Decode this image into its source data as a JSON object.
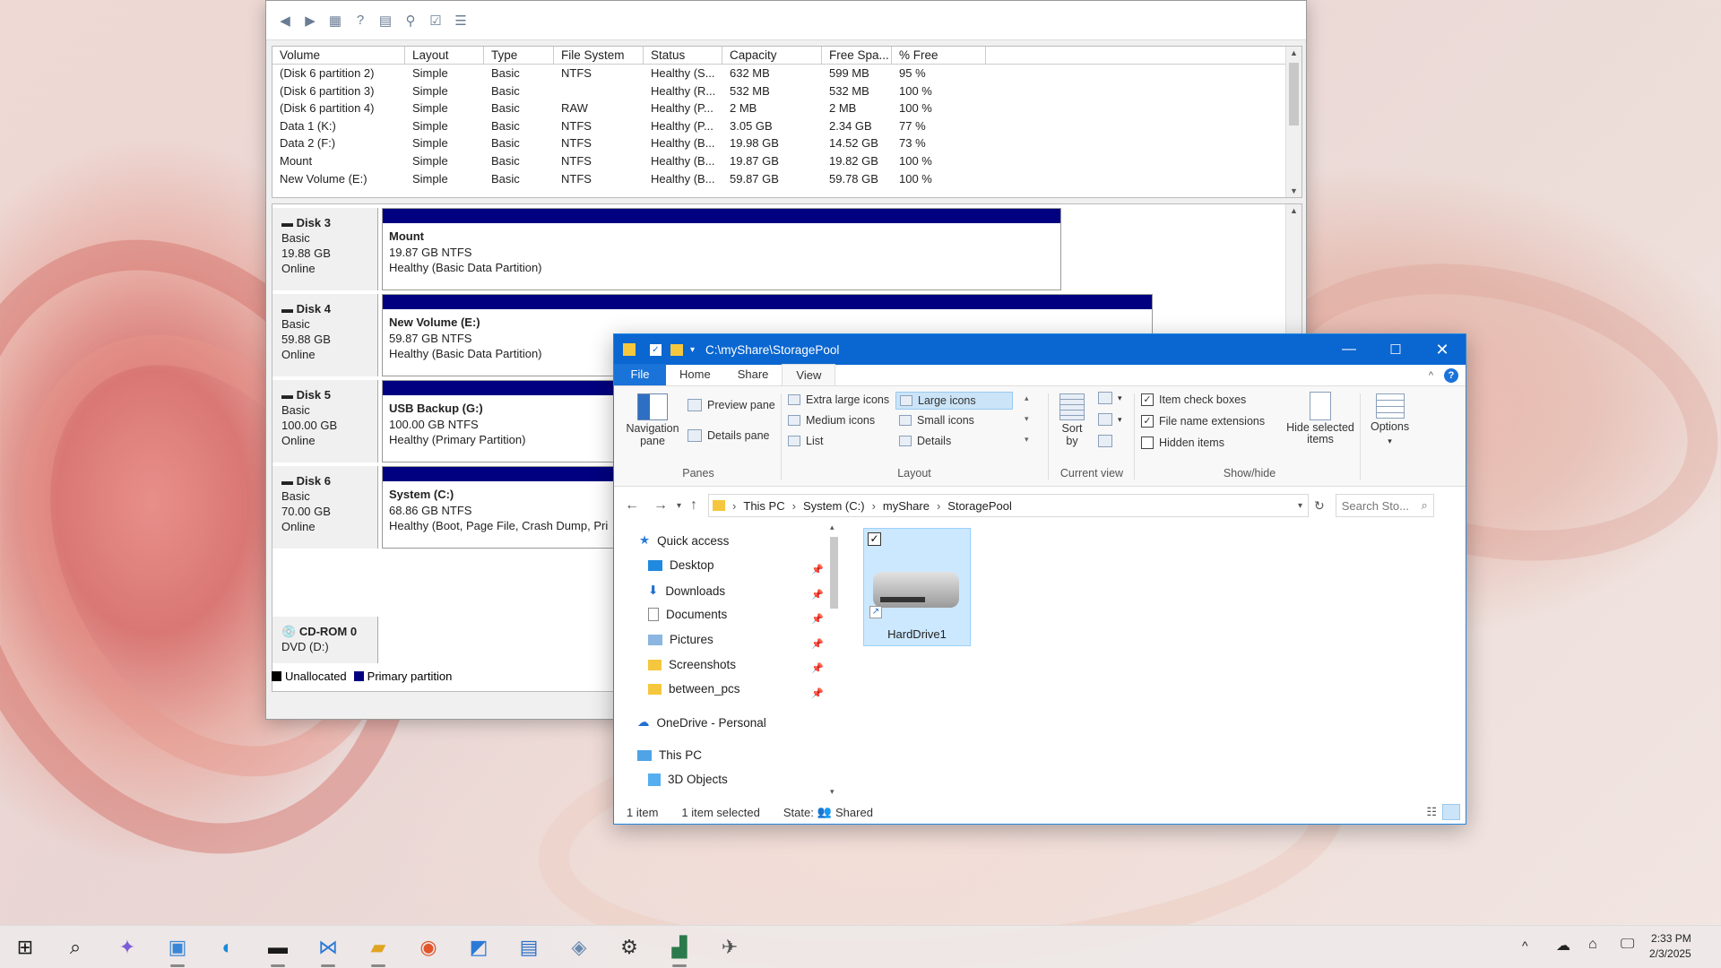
{
  "disk_mgmt": {
    "columns": [
      "Volume",
      "Layout",
      "Type",
      "File System",
      "Status",
      "Capacity",
      "Free Spa...",
      "% Free"
    ],
    "rows": [
      [
        "(Disk 6 partition 2)",
        "Simple",
        "Basic",
        "NTFS",
        "Healthy (S...",
        "632 MB",
        "599 MB",
        "95 %"
      ],
      [
        "(Disk 6 partition 3)",
        "Simple",
        "Basic",
        "",
        "Healthy (R...",
        "532 MB",
        "532 MB",
        "100 %"
      ],
      [
        "(Disk 6 partition 4)",
        "Simple",
        "Basic",
        "RAW",
        "Healthy (P...",
        "2 MB",
        "2 MB",
        "100 %"
      ],
      [
        "Data 1 (K:)",
        "Simple",
        "Basic",
        "NTFS",
        "Healthy (P...",
        "3.05 GB",
        "2.34 GB",
        "77 %"
      ],
      [
        "Data 2 (F:)",
        "Simple",
        "Basic",
        "NTFS",
        "Healthy (B...",
        "19.98 GB",
        "14.52 GB",
        "73 %"
      ],
      [
        "Mount",
        "Simple",
        "Basic",
        "NTFS",
        "Healthy (B...",
        "19.87 GB",
        "19.82 GB",
        "100 %"
      ],
      [
        "New Volume (E:)",
        "Simple",
        "Basic",
        "NTFS",
        "Healthy (B...",
        "59.87 GB",
        "59.78 GB",
        "100 %"
      ]
    ],
    "disks": [
      {
        "name": "Disk 3",
        "type": "Basic",
        "size": "19.88 GB",
        "state": "Online",
        "part_name": "Mount",
        "part_size": "19.87 GB NTFS",
        "part_status": "Healthy (Basic Data Partition)"
      },
      {
        "name": "Disk 4",
        "type": "Basic",
        "size": "59.88 GB",
        "state": "Online",
        "part_name": "New Volume  (E:)",
        "part_size": "59.87 GB NTFS",
        "part_status": "Healthy (Basic Data Partition)"
      },
      {
        "name": "Disk 5",
        "type": "Basic",
        "size": "100.00 GB",
        "state": "Online",
        "part_name": "USB Backup  (G:)",
        "part_size": "100.00 GB NTFS",
        "part_status": "Healthy (Primary Partition)"
      },
      {
        "name": "Disk 6",
        "type": "Basic",
        "size": "70.00 GB",
        "state": "Online",
        "part_name": "System  (C:)",
        "part_size": "68.86 GB NTFS",
        "part_status": "Healthy (Boot, Page File, Crash Dump, Pri"
      }
    ],
    "cdrom": {
      "name": "CD-ROM 0",
      "drive": "DVD (D:)"
    },
    "legend": {
      "unallocated": "Unallocated",
      "primary": "Primary partition"
    }
  },
  "explorer": {
    "title": "C:\\myShare\\StoragePool",
    "tabs": {
      "file": "File",
      "home": "Home",
      "share": "Share",
      "view": "View"
    },
    "ribbon": {
      "nav_pane": "Navigation pane",
      "preview_pane": "Preview pane",
      "details_pane": "Details pane",
      "panes_label": "Panes",
      "xl_icons": "Extra large icons",
      "large_icons": "Large icons",
      "medium_icons": "Medium icons",
      "small_icons": "Small icons",
      "list": "List",
      "details": "Details",
      "layout_label": "Layout",
      "sort_by": "Sort by",
      "current_view_label": "Current view",
      "item_check_boxes": "Item check boxes",
      "file_name_ext": "File name extensions",
      "hidden_items": "Hidden items",
      "hide_selected": "Hide selected items",
      "showhide_label": "Show/hide",
      "options": "Options"
    },
    "breadcrumb": [
      "This PC",
      "System (C:)",
      "myShare",
      "StoragePool"
    ],
    "search_placeholder": "Search Sto...",
    "nav": {
      "quick_access": "Quick access",
      "desktop": "Desktop",
      "downloads": "Downloads",
      "documents": "Documents",
      "pictures": "Pictures",
      "screenshots": "Screenshots",
      "between_pcs": "between_pcs",
      "onedrive": "OneDrive - Personal",
      "this_pc": "This PC",
      "objects3d": "3D Objects"
    },
    "item": {
      "name": "HardDrive1"
    },
    "status": {
      "count": "1 item",
      "selected": "1 item selected",
      "state": "State:",
      "state_val": "Shared"
    }
  },
  "taskbar": {
    "time": "2:33 PM",
    "date": "2/3/2025"
  },
  "colors": {
    "accent": "#0a66d0",
    "partition_bar": "#000080"
  }
}
